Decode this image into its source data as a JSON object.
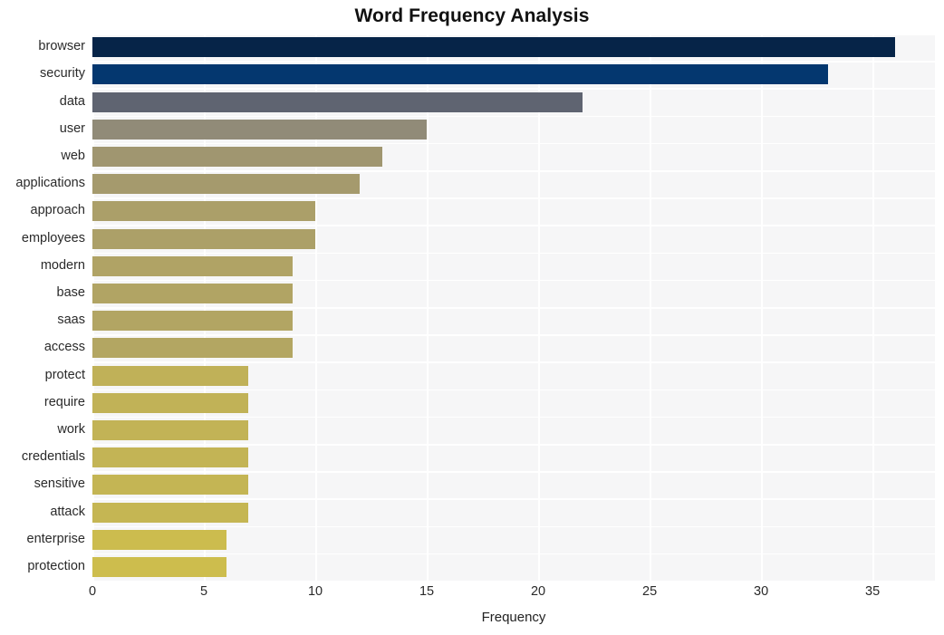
{
  "chart_data": {
    "type": "bar",
    "orientation": "horizontal",
    "title": "Word Frequency Analysis",
    "xlabel": "Frequency",
    "ylabel": "",
    "xlim": [
      0,
      37.8
    ],
    "xticks": [
      0,
      5,
      10,
      15,
      20,
      25,
      30,
      35
    ],
    "xtick_labels": [
      "0",
      "5",
      "10",
      "15",
      "20",
      "25",
      "30",
      "35"
    ],
    "grid": true,
    "grid_color": "#ffffff",
    "plot_background": "#f6f6f7",
    "figure_background": "#ffffff",
    "legend": null,
    "categories": [
      "browser",
      "security",
      "data",
      "user",
      "web",
      "applications",
      "approach",
      "employees",
      "modern",
      "base",
      "saas",
      "access",
      "protect",
      "require",
      "work",
      "credentials",
      "sensitive",
      "attack",
      "enterprise",
      "protection"
    ],
    "values": [
      36,
      33,
      22,
      15,
      13,
      12,
      10,
      10,
      9,
      9,
      9,
      9,
      7,
      7,
      7,
      7,
      7,
      7,
      6,
      6
    ],
    "bar_colors": [
      "#062448",
      "#04376f",
      "#5f6471",
      "#918b78",
      "#a09670",
      "#a59a6d",
      "#ab9f69",
      "#ac a068",
      "#b0a365",
      "#b1a464",
      "#b2a563",
      "#b3a662",
      "#c0b158",
      "#c1b257",
      "#c2b356",
      "#c3b455",
      "#c4b554",
      "#c5b653",
      "#ccbc4e",
      "#cdbd4d"
    ]
  },
  "axis": {
    "x_label": "Frequency"
  }
}
